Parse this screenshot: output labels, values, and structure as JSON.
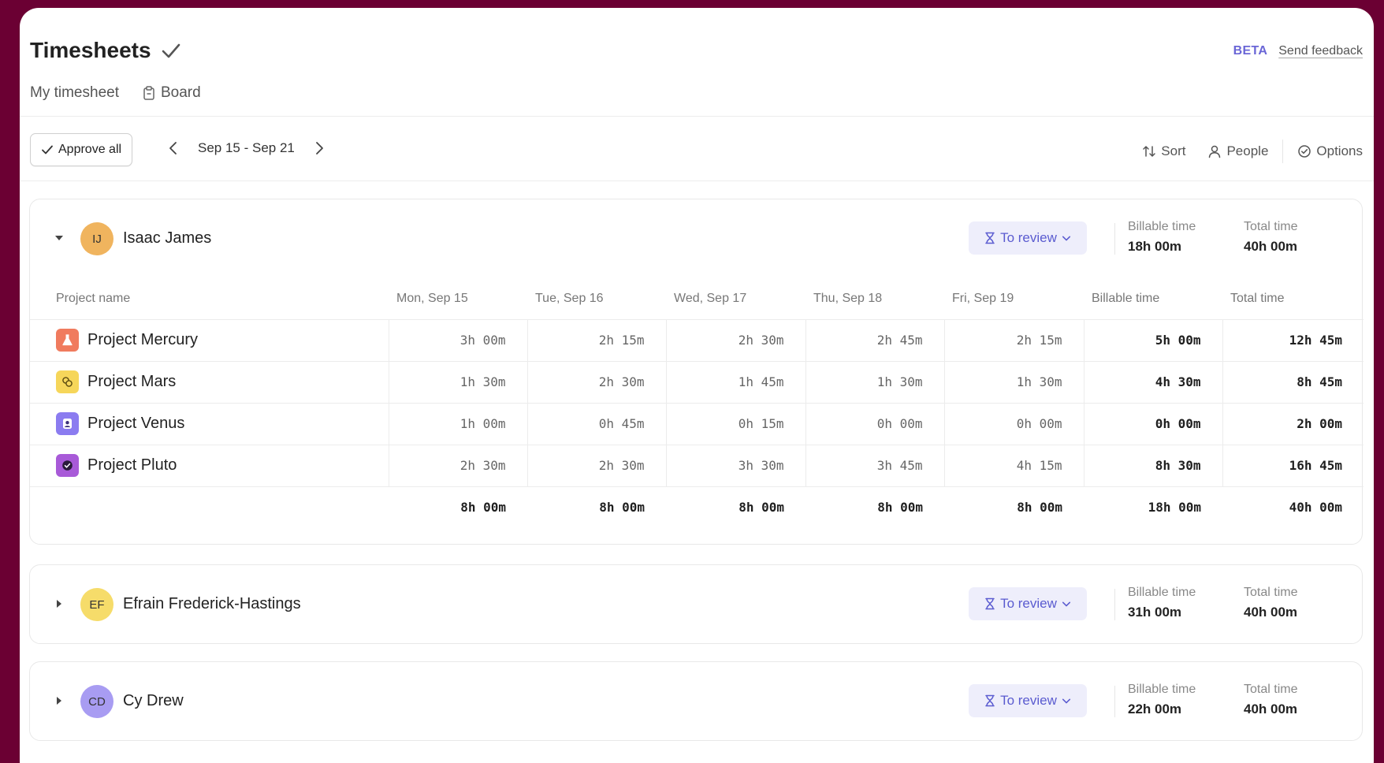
{
  "header": {
    "title": "Timesheets",
    "beta": "BETA",
    "feedback": "Send feedback",
    "tabs": [
      {
        "label": "My timesheet",
        "icon": null
      },
      {
        "label": "Board",
        "icon": "clipboard-icon"
      }
    ]
  },
  "toolbar": {
    "approve_all": "Approve all",
    "date_range": "Sep 15 - Sep 21",
    "sort": "Sort",
    "people": "People",
    "options": "Options"
  },
  "columns": [
    "Project name",
    "Mon, Sep 15",
    "Tue, Sep 16",
    "Wed, Sep 17",
    "Thu, Sep 18",
    "Fri, Sep 19",
    "Billable time",
    "Total time"
  ],
  "stat_labels": {
    "billable": "Billable time",
    "total": "Total time"
  },
  "people": [
    {
      "initials": "IJ",
      "name": "Isaac James",
      "avatar_color": "#f0b45e",
      "status": "To review",
      "billable": "18h 00m",
      "total": "40h 00m",
      "expanded": true,
      "projects": [
        {
          "name": "Project Mercury",
          "icon": "flask-icon",
          "color": "#f07b5e",
          "days": [
            "3h 00m",
            "2h 15m",
            "2h 30m",
            "2h 45m",
            "2h 15m"
          ],
          "billable": "5h 00m",
          "total": "12h 45m"
        },
        {
          "name": "Project Mars",
          "icon": "coins-icon",
          "color": "#f6d65a",
          "days": [
            "1h 30m",
            "2h 30m",
            "1h 45m",
            "1h 30m",
            "1h 30m"
          ],
          "billable": "4h 30m",
          "total": "8h 45m"
        },
        {
          "name": "Project Venus",
          "icon": "person-badge-icon",
          "color": "#8b7cf0",
          "days": [
            "1h 00m",
            "0h 45m",
            "0h 15m",
            "0h 00m",
            "0h 00m"
          ],
          "billable": "0h 00m",
          "total": "2h 00m"
        },
        {
          "name": "Project Pluto",
          "icon": "check-circle-icon",
          "color": "#a85ad8",
          "days": [
            "2h 30m",
            "2h 30m",
            "3h 30m",
            "3h 45m",
            "4h 15m"
          ],
          "billable": "8h 30m",
          "total": "16h 45m"
        }
      ],
      "totals": {
        "days": [
          "8h 00m",
          "8h 00m",
          "8h 00m",
          "8h 00m",
          "8h 00m"
        ],
        "billable": "18h 00m",
        "total": "40h 00m"
      }
    },
    {
      "initials": "EF",
      "name": "Efrain Frederick-Hastings",
      "avatar_color": "#f6dc6a",
      "status": "To review",
      "billable": "31h 00m",
      "total": "40h 00m",
      "expanded": false
    },
    {
      "initials": "CD",
      "name": "Cy Drew",
      "avatar_color": "#a89cf2",
      "status": "To review",
      "billable": "22h 00m",
      "total": "40h 00m",
      "expanded": false
    }
  ]
}
